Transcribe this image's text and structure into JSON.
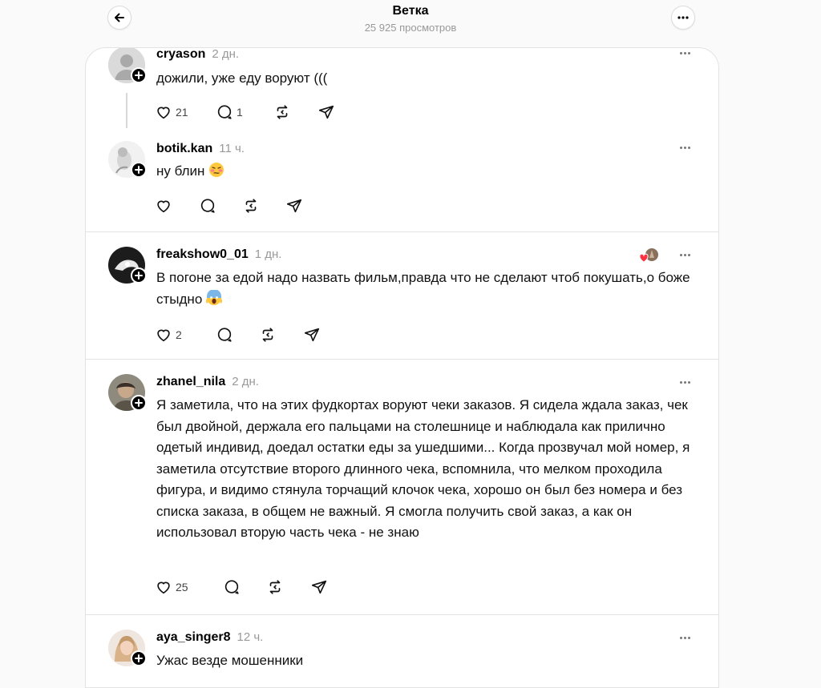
{
  "header": {
    "title": "Ветка",
    "subtitle": "25 925 просмотров",
    "back_icon": "arrow-left-icon",
    "more_icon": "more-dots-icon"
  },
  "posts": [
    {
      "username": "cryason",
      "time": "2 дн.",
      "text": "дожили, уже еду воруют (((",
      "likes": "21",
      "comments": "1",
      "reposts": "",
      "avatar": "default-avatar"
    },
    {
      "username": "botik.kan",
      "time": "11 ч.",
      "text": "ну блин",
      "emoji": "woozy-face-emoji",
      "likes": "",
      "comments": "",
      "reposts": "",
      "avatar": "photo-avatar"
    },
    {
      "username": "freakshow0_01",
      "time": "1 дн.",
      "text": "В погоне за едой надо назвать фильм,правда что не сделают чтоб покушать,о боже стыдно",
      "emoji": "screaming-face-emoji",
      "likes": "2",
      "comments": "",
      "reposts": "",
      "avatar": "photo-avatar",
      "reaction_icon": "heart-reaction-icon"
    },
    {
      "username": "zhanel_nila",
      "time": "2 дн.",
      "text": "Я заметила, что на этих фудкортах воруют чеки заказов. Я сидела ждала заказ, чек был двойной, держала его пальцами на столешнице и наблюдала как прилично одетый индивид, доедал остатки еды за ушедшими... Когда прозвучал мой номер, я заметила отсутствие второго длинного чека, вспомнила, что мелком проходила фигура, и видимо стянула торчащий клочок чека, хорошо он был без номера и без списка заказа, в общем не важный. Я смогла получить свой заказ, а как он использовал вторую часть чека - не знаю",
      "likes": "25",
      "comments": "",
      "reposts": "",
      "avatar": "photo-avatar"
    },
    {
      "username": "aya_singer8",
      "time": "12 ч.",
      "text": "Ужас везде мошенники",
      "avatar": "photo-avatar"
    }
  ],
  "colors": {
    "background": "#fafafa",
    "card": "#ffffff",
    "border": "#e3e3e3",
    "muted": "#999999",
    "heart_reaction": "#ff3040"
  }
}
